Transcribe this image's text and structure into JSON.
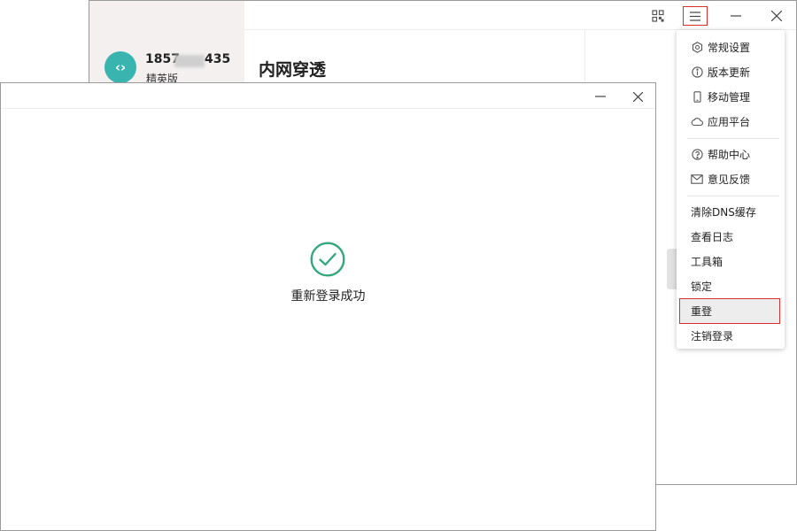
{
  "main_window": {
    "user": {
      "avatar_glyph": "‹›",
      "phone_prefix": "1857",
      "phone_suffix": "435",
      "plan": "精英版"
    },
    "page_title": "内网穿透",
    "titlebar_icons": [
      "qr-code-icon",
      "hamburger-menu-icon",
      "minimize-icon",
      "close-icon"
    ]
  },
  "menu": {
    "items": [
      {
        "label": "常规设置",
        "icon": "gear-icon"
      },
      {
        "label": "版本更新",
        "icon": "info-icon"
      },
      {
        "label": "移动管理",
        "icon": "phone-icon"
      },
      {
        "label": "应用平台",
        "icon": "cloud-icon"
      },
      {
        "label": "帮助中心",
        "icon": "help-icon"
      },
      {
        "label": "意见反馈",
        "icon": "mail-icon"
      },
      {
        "label": "清除DNS缓存"
      },
      {
        "label": "查看日志"
      },
      {
        "label": "工具箱"
      },
      {
        "label": "锁定"
      },
      {
        "label": "重登"
      },
      {
        "label": "注销登录"
      }
    ]
  },
  "dialog": {
    "message": "重新登录成功"
  },
  "colors": {
    "success": "#34a77d",
    "highlight_border": "#d9302c",
    "avatar": "#39b4ae",
    "sidebar_bg": "#f4f0f0"
  }
}
